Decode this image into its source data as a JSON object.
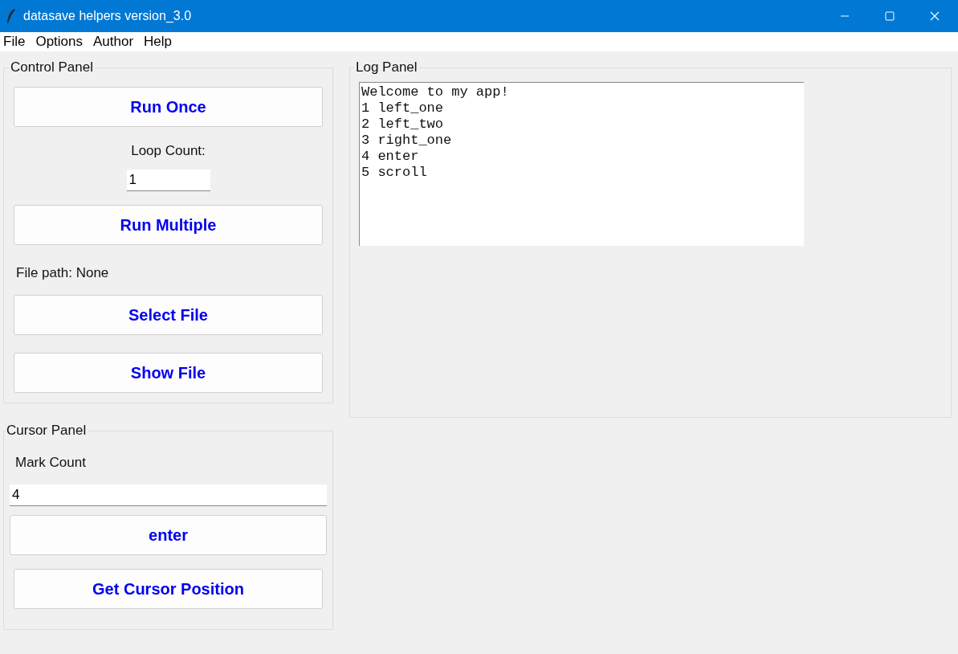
{
  "window": {
    "title": "datasave helpers version_3.0"
  },
  "menu": [
    "File",
    "Options",
    "Author",
    "Help"
  ],
  "control_panel": {
    "title": "Control Panel",
    "items": [
      {
        "kind": "button",
        "label": "Run Once"
      },
      {
        "kind": "entry",
        "label": "Loop Count:",
        "value": "1"
      },
      {
        "kind": "button",
        "label": "Run Multiple"
      },
      {
        "kind": "text",
        "label": "File path: None"
      },
      {
        "kind": "button",
        "label": "Select File"
      },
      {
        "kind": "button",
        "label": "Show File"
      }
    ]
  },
  "cursor_panel": {
    "title": "Cursor Panel",
    "items": [
      {
        "kind": "wide_entry",
        "label": "Mark Count",
        "value": "4"
      },
      {
        "kind": "wide_button",
        "label": "enter"
      },
      {
        "kind": "button",
        "label": "Get Cursor Position"
      }
    ]
  },
  "log_panel": {
    "title": "Log Panel",
    "lines": [
      "Welcome to my app!",
      "1 left_one",
      "2 left_two",
      "3 right_one",
      "4 enter",
      "5 scroll"
    ]
  }
}
